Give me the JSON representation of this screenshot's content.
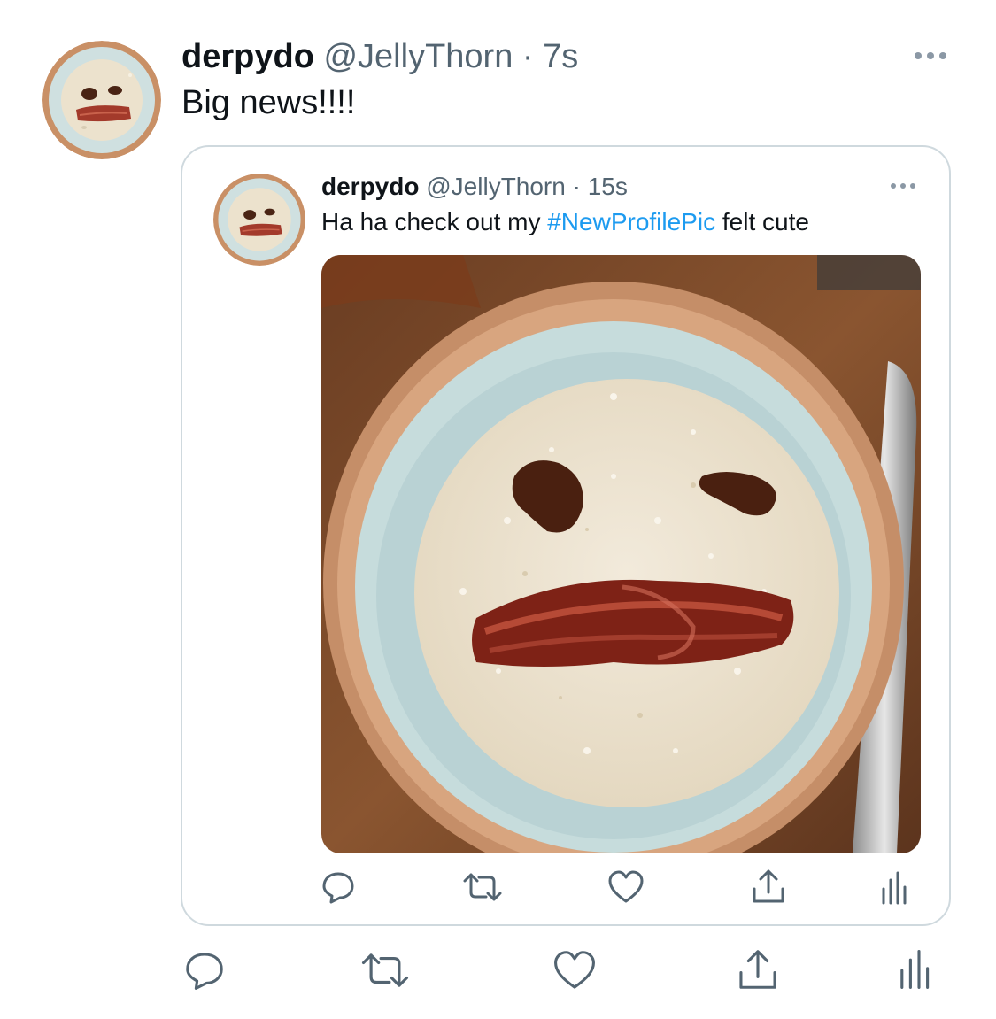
{
  "tweet": {
    "display_name": "derpydo",
    "handle": "@JellyThorn",
    "separator": "·",
    "time": "7s",
    "text": "Big news!!!!",
    "more_icon": "more-horizontal-icon",
    "actions": [
      "reply-icon",
      "retweet-icon",
      "like-icon",
      "share-icon",
      "analytics-icon"
    ]
  },
  "quoted": {
    "display_name": "derpydo",
    "handle": "@JellyThorn",
    "separator": "·",
    "time": "15s",
    "text_before": "Ha ha check out my ",
    "hashtag": "#NewProfilePic",
    "text_after": " felt cute",
    "more_icon": "more-horizontal-icon",
    "actions": [
      "reply-icon",
      "retweet-icon",
      "like-icon",
      "share-icon",
      "analytics-icon"
    ]
  },
  "colors": {
    "accent": "#1d9bf0",
    "muted_text": "#536471",
    "icon": "#536471",
    "border": "#cfd9de"
  }
}
